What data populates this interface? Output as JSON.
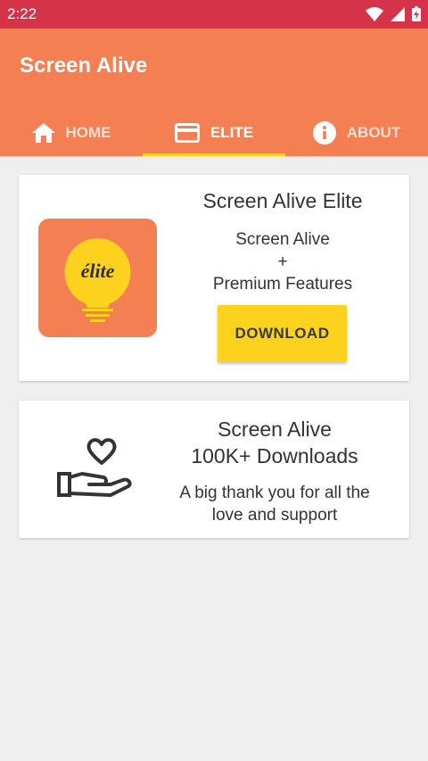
{
  "status_bar": {
    "time": "2:22",
    "icons": [
      "wifi-icon",
      "signal-icon",
      "battery-charging-icon"
    ]
  },
  "app_bar": {
    "title": "Screen Alive",
    "color": "#f37f53"
  },
  "tabs": [
    {
      "label": "HOME",
      "icon": "home-icon",
      "active": false
    },
    {
      "label": "ELITE",
      "icon": "card-icon",
      "active": true
    },
    {
      "label": "ABOUT",
      "icon": "info-icon",
      "active": false
    }
  ],
  "elite_card": {
    "title": "Screen Alive Elite",
    "subtitle_lines": [
      "Screen Alive",
      "+",
      "Premium Features"
    ],
    "logo_text": "élite",
    "download_label": "DOWNLOAD",
    "accent": "#fdd21f"
  },
  "thanks_card": {
    "title_lines": [
      "Screen Alive",
      "100K+ Downloads"
    ],
    "message_lines": [
      "A big thank you for all the",
      "love and support"
    ],
    "icon": "heart-hand-icon"
  },
  "colors": {
    "status_bar": "#d4334a",
    "background": "#efefef",
    "tab_indicator": "#ffd21e"
  }
}
